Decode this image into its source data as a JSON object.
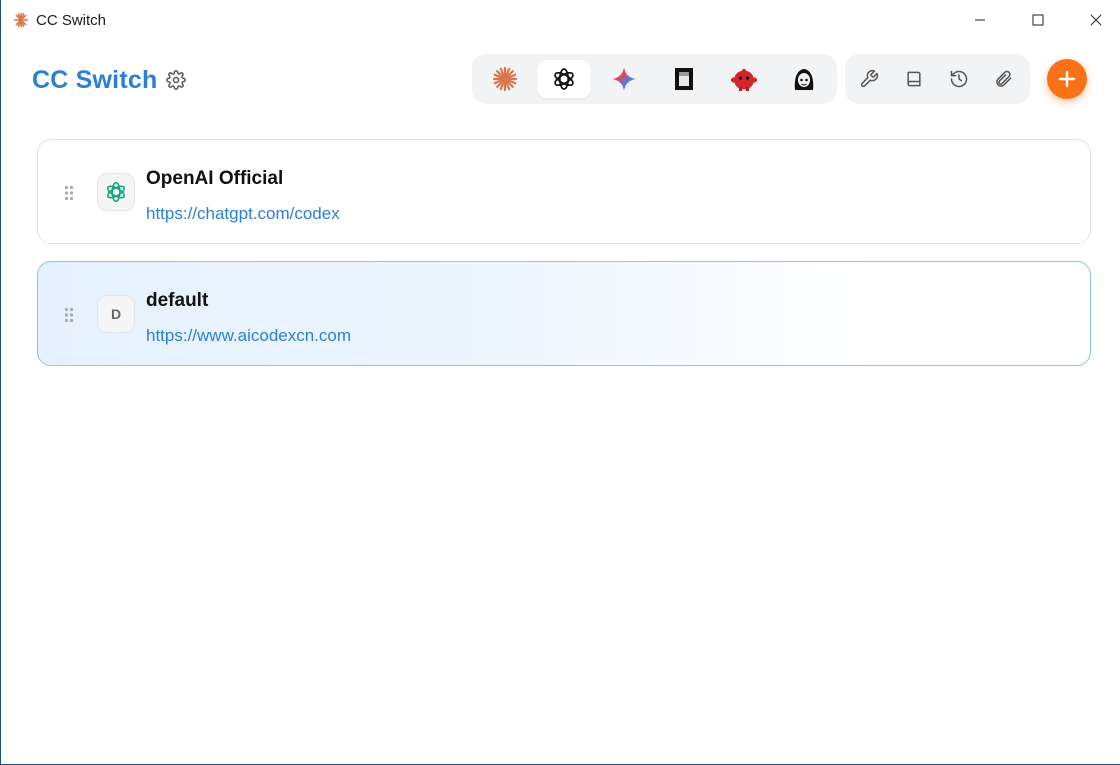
{
  "window": {
    "title": "CC Switch",
    "controls": [
      "minimize-icon",
      "maximize-icon",
      "close-icon"
    ]
  },
  "header": {
    "brand": "CC Switch",
    "settings_icon": "gear-icon",
    "app_tabs": [
      {
        "icon": "claude-starburst-icon",
        "active": false
      },
      {
        "icon": "openai-logo-icon",
        "active": true
      },
      {
        "icon": "gemini-sparkle-icon",
        "active": false
      },
      {
        "icon": "black-square-app-icon",
        "active": false
      },
      {
        "icon": "red-creature-icon",
        "active": false
      },
      {
        "icon": "character-avatar-icon",
        "active": false
      }
    ],
    "utility_buttons": [
      "wrench-icon",
      "book-icon",
      "history-icon",
      "paperclip-icon"
    ],
    "add_button_icon": "plus-icon",
    "accent": "#2b7fd6",
    "add_color": "#f97316"
  },
  "providers": [
    {
      "name": "OpenAI Official",
      "url": "https://chatgpt.com/codex",
      "avatar_icon": "openai-logo-icon",
      "selected": false
    },
    {
      "name": "default",
      "url": "https://www.aicodexcn.com",
      "avatar_letter": "D",
      "selected": true
    }
  ]
}
